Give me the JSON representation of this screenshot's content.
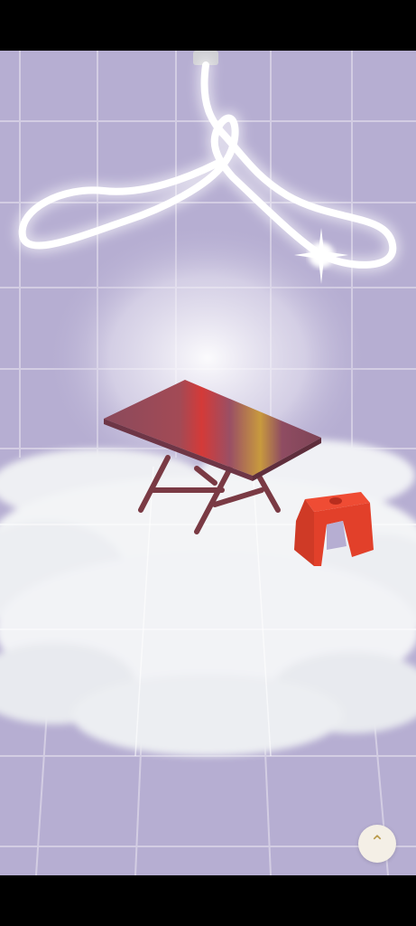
{
  "scroll_button": {
    "icon": "chevron-up-icon"
  },
  "colors": {
    "background": "#b6aed2",
    "grid": "#d3cde3",
    "neon": "#ffffff",
    "table_top": "#8a4a5c",
    "table_legs": "#7a3a44",
    "stool": "#e2402a",
    "cloud": "#f3f4f6",
    "button": "#f4efe6",
    "chevron": "#b99a4a"
  }
}
